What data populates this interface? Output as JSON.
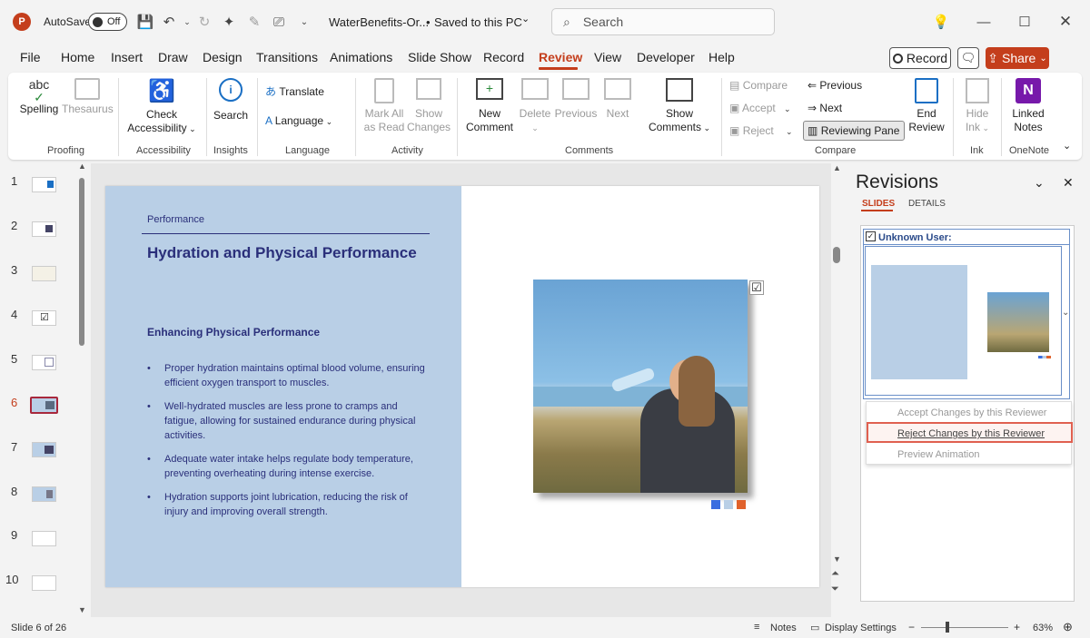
{
  "titlebar": {
    "autosave": "AutoSave",
    "toggle": "Off",
    "filename": "WaterBenefits-Or...",
    "saved": "Saved to this PC",
    "search_placeholder": "Search"
  },
  "menu": [
    "File",
    "Home",
    "Insert",
    "Draw",
    "Design",
    "Transitions",
    "Animations",
    "Slide Show",
    "Record",
    "Review",
    "View",
    "Developer",
    "Help"
  ],
  "record_button": "Record",
  "share_button": "Share",
  "ribbon": {
    "spelling": "Spelling",
    "thesaurus": "Thesaurus",
    "check_accessibility_1": "Check",
    "check_accessibility_2": "Accessibility",
    "search": "Search",
    "translate": "Translate",
    "language": "Language",
    "mark_all_1": "Mark All",
    "mark_all_2": "as Read",
    "show_changes_1": "Show",
    "show_changes_2": "Changes",
    "new_comment_1": "New",
    "new_comment_2": "Comment",
    "delete": "Delete",
    "previous": "Previous",
    "next": "Next",
    "show_comments_1": "Show",
    "show_comments_2": "Comments",
    "compare": "Compare",
    "accept": "Accept",
    "reject": "Reject",
    "previous2": "Previous",
    "next2": "Next",
    "reviewing_pane": "Reviewing Pane",
    "end_review_1": "End",
    "end_review_2": "Review",
    "hide_ink_1": "Hide",
    "hide_ink_2": "Ink",
    "linked_notes_1": "Linked",
    "linked_notes_2": "Notes",
    "groups": {
      "proofing": "Proofing",
      "accessibility": "Accessibility",
      "insights": "Insights",
      "language": "Language",
      "activity": "Activity",
      "comments": "Comments",
      "compare": "Compare",
      "ink": "Ink",
      "onenote": "OneNote"
    }
  },
  "slide_numbers": [
    "1",
    "2",
    "3",
    "4",
    "5",
    "6",
    "7",
    "8",
    "9",
    "10"
  ],
  "slide": {
    "section": "Performance",
    "title": "Hydration and Physical Performance",
    "subtitle": "Enhancing Physical Performance",
    "bullets": [
      "Proper hydration maintains optimal blood volume, ensuring efficient oxygen transport to muscles.",
      "Well-hydrated muscles are less prone to cramps and fatigue, allowing for sustained endurance during physical activities.",
      "Adequate water intake helps regulate body temperature, preventing overheating during intense exercise.",
      "Hydration supports joint lubrication, reducing the risk of injury and improving overall strength."
    ]
  },
  "revisions": {
    "title": "Revisions",
    "tab_slides": "SLIDES",
    "tab_details": "DETAILS",
    "reviewer": "Unknown User:",
    "menu": [
      "Accept Changes by this Reviewer",
      "Reject Changes by this Reviewer",
      "Preview Animation"
    ]
  },
  "status": {
    "slide_info": "Slide 6 of 26",
    "notes": "Notes",
    "display_settings": "Display Settings",
    "zoom": "63%"
  },
  "colors": {
    "accent": "#c43e1c",
    "slide_left_bg": "#b9cfe6",
    "slide_title": "#2a2f7a",
    "highlight_border": "#e06050"
  }
}
